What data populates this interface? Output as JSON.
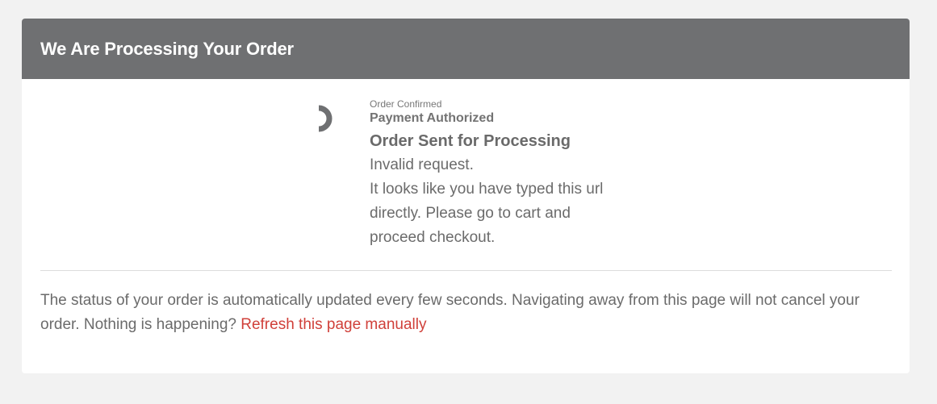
{
  "header": {
    "title": "We Are Processing Your Order"
  },
  "status": {
    "spinner_icon": "loading-spinner-icon",
    "steps": {
      "order_confirmed": "Order Confirmed",
      "payment_authorized": "Payment Authorized",
      "order_sent": "Order Sent for Processing"
    },
    "message_lines": [
      "Invalid request.",
      "It looks like you have typed this url",
      "directly. Please go to cart and",
      "proceed checkout."
    ]
  },
  "footer": {
    "text": "The status of your order is automatically updated every few seconds. Navigating away from this page will not cancel your order. Nothing is happening? ",
    "refresh_link": "Refresh this page manually"
  },
  "colors": {
    "header_bg": "#6f7072",
    "link": "#d0403a",
    "page_bg": "#f2f2f2"
  }
}
